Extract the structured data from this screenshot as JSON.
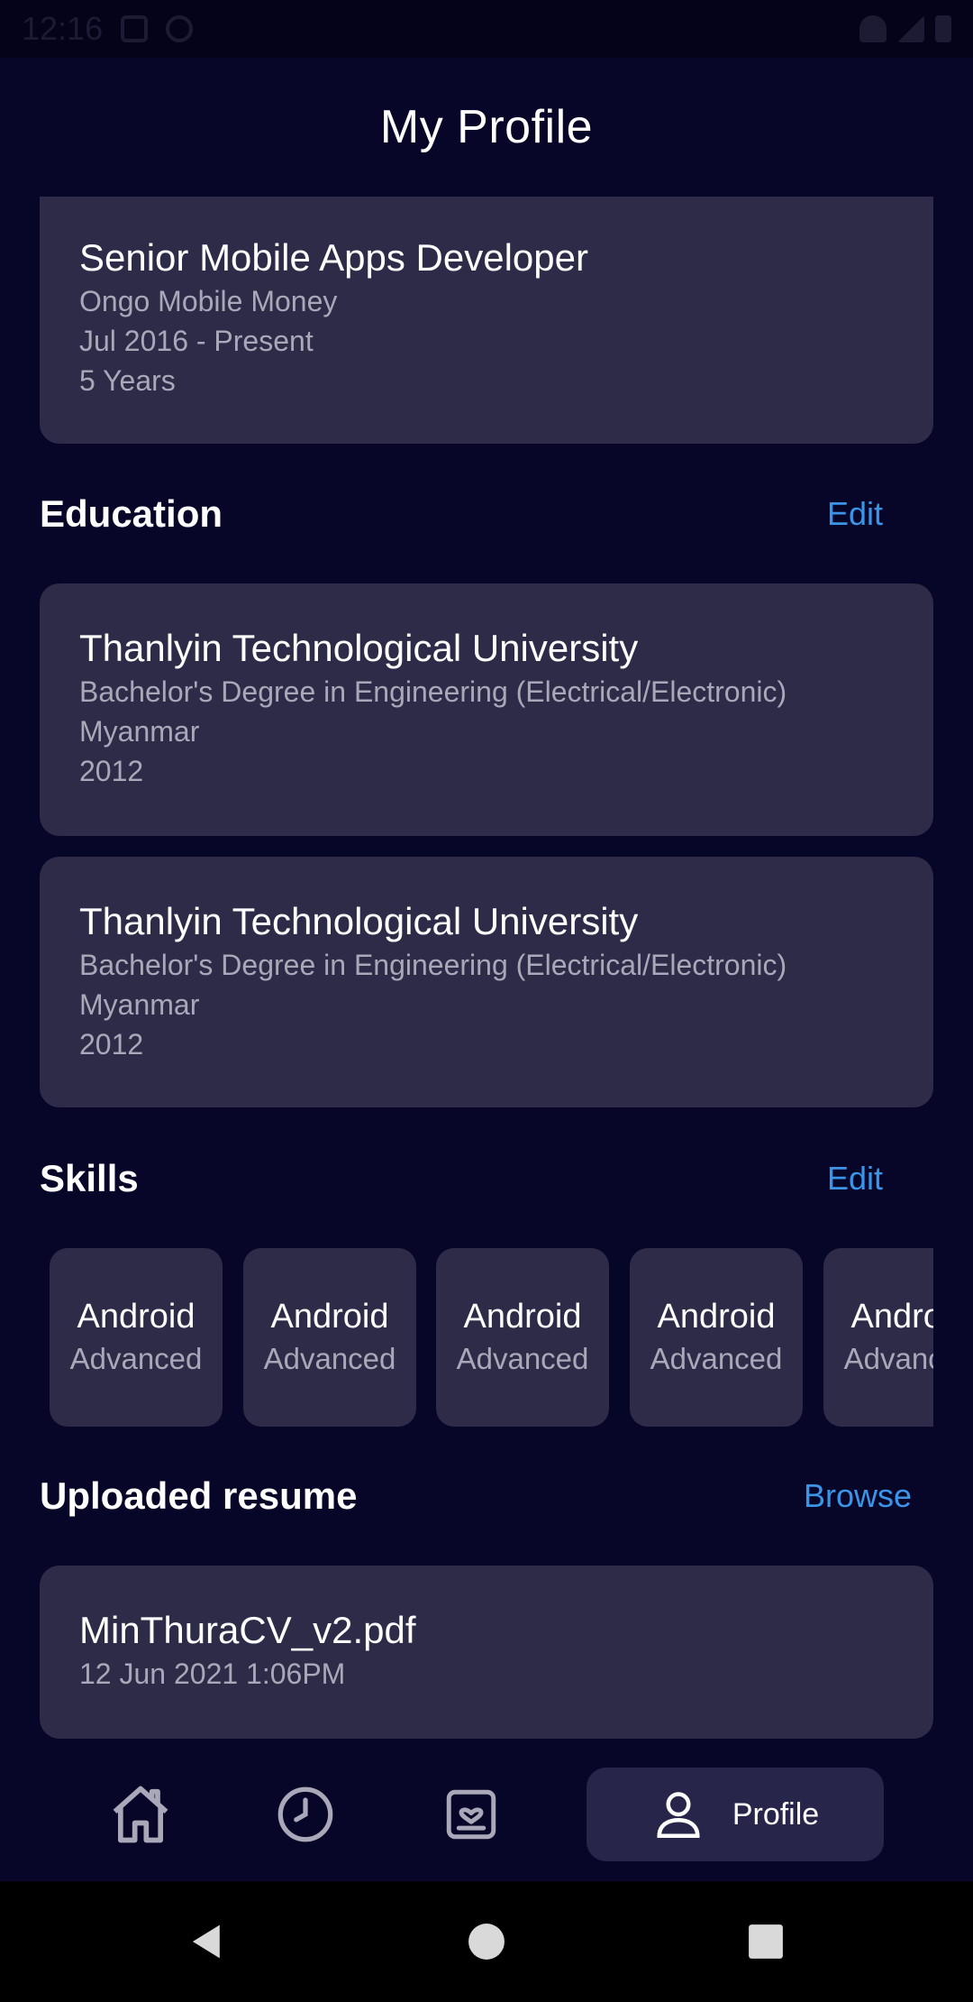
{
  "status_bar": {
    "time": "12:16"
  },
  "header": {
    "title": "My Profile"
  },
  "experience": {
    "title": "Senior Mobile Apps Developer",
    "company": "Ongo Mobile Money",
    "period": "Jul 2016 - Present",
    "duration": "5 Years"
  },
  "education": {
    "section_title": "Education",
    "edit_label": "Edit",
    "items": [
      {
        "school": "Thanlyin Technological University",
        "degree": "Bachelor's Degree in Engineering (Electrical/Electronic)",
        "country": "Myanmar",
        "year": "2012"
      },
      {
        "school": "Thanlyin Technological University",
        "degree": "Bachelor's Degree in Engineering (Electrical/Electronic)",
        "country": "Myanmar",
        "year": "2012"
      }
    ]
  },
  "skills": {
    "section_title": "Skills",
    "edit_label": "Edit",
    "items": [
      {
        "name": "Android",
        "level": "Advanced"
      },
      {
        "name": "Android",
        "level": "Advanced"
      },
      {
        "name": "Android",
        "level": "Advanced"
      },
      {
        "name": "Android",
        "level": "Advanced"
      },
      {
        "name": "Android",
        "level": "Advanced"
      }
    ]
  },
  "resume": {
    "section_title": "Uploaded resume",
    "browse_label": "Browse",
    "file_name": "MinThuraCV_v2.pdf",
    "uploaded_at": "12 Jun 2021 1:06PM"
  },
  "bottom_nav": {
    "items": [
      {
        "icon": "home-icon"
      },
      {
        "icon": "history-clock-icon"
      },
      {
        "icon": "saved-jobs-icon"
      },
      {
        "icon": "profile-icon",
        "label": "Profile",
        "active": true
      }
    ]
  },
  "colors": {
    "background": "#070528",
    "card": "#2d2b47",
    "accent": "#3a95e8",
    "muted_text": "#a9a8b9"
  }
}
